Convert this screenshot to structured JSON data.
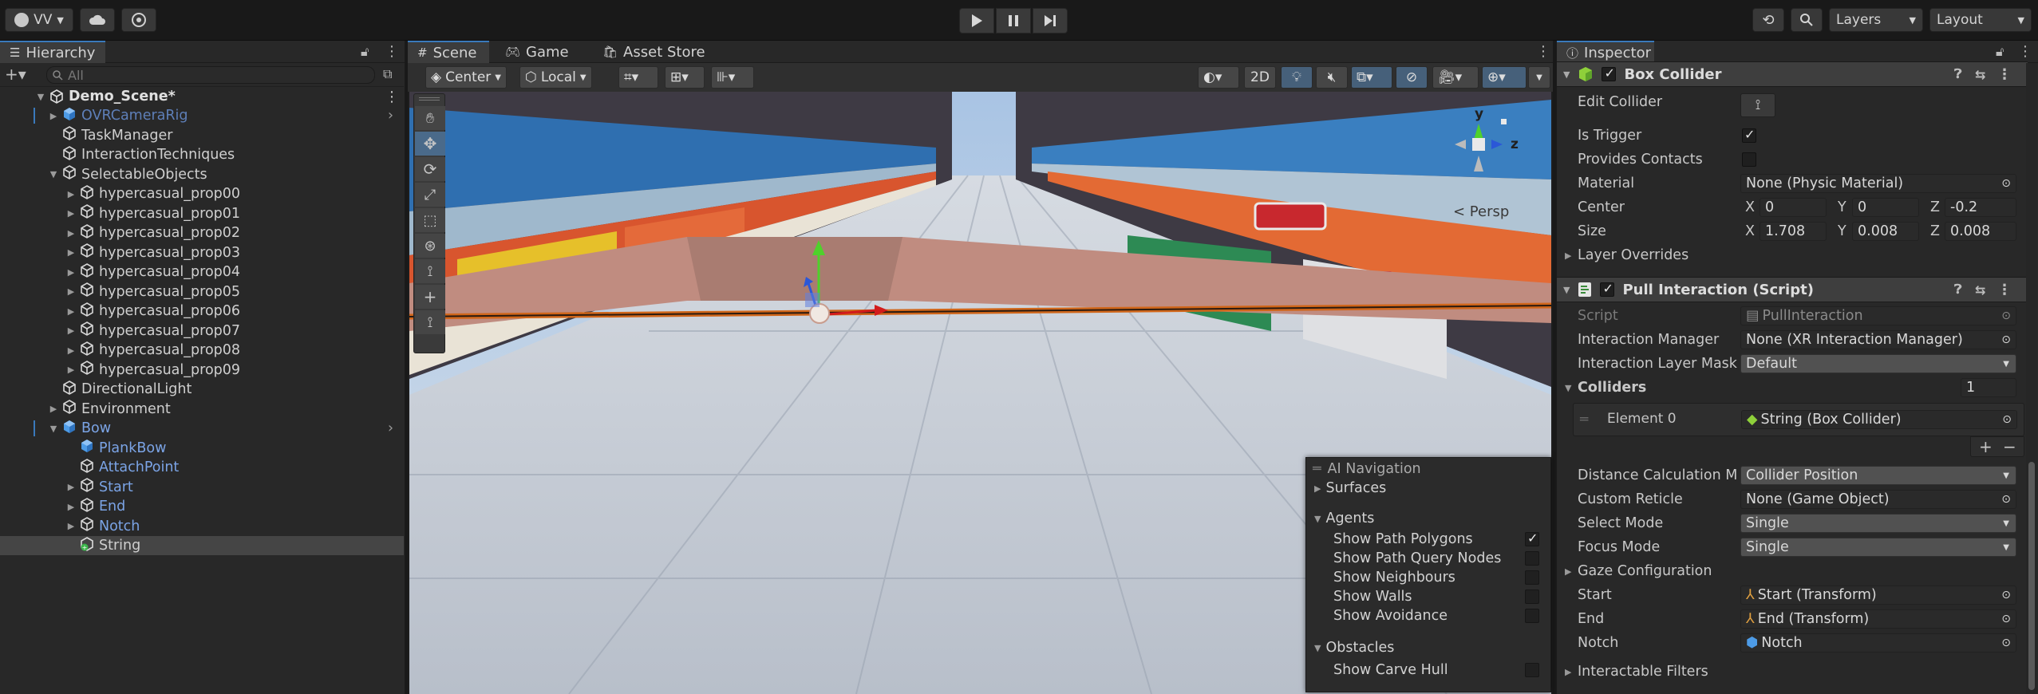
{
  "toolbar": {
    "account": "VV",
    "play_controls": [
      "play",
      "pause",
      "step"
    ],
    "layers_label": "Layers",
    "layout_label": "Layout"
  },
  "hierarchy": {
    "tab_label": "Hierarchy",
    "search_placeholder": "All",
    "scene_name": "Demo_Scene*",
    "items": [
      {
        "label": "OVRCameraRig",
        "depth": 1,
        "expand": "collapsed",
        "style": "prefab-faded",
        "icon": "prefab-cube-icon"
      },
      {
        "label": "TaskManager",
        "depth": 1,
        "expand": "none",
        "style": "normal",
        "icon": "gameobject-icon"
      },
      {
        "label": "InteractionTechniques",
        "depth": 1,
        "expand": "none",
        "style": "normal",
        "icon": "gameobject-icon"
      },
      {
        "label": "SelectableObjects",
        "depth": 1,
        "expand": "expanded",
        "style": "normal",
        "icon": "gameobject-icon"
      },
      {
        "label": "hypercasual_prop00",
        "depth": 2,
        "expand": "collapsed",
        "style": "normal",
        "icon": "gameobject-icon"
      },
      {
        "label": "hypercasual_prop01",
        "depth": 2,
        "expand": "collapsed",
        "style": "normal",
        "icon": "gameobject-icon"
      },
      {
        "label": "hypercasual_prop02",
        "depth": 2,
        "expand": "collapsed",
        "style": "normal",
        "icon": "gameobject-icon"
      },
      {
        "label": "hypercasual_prop03",
        "depth": 2,
        "expand": "collapsed",
        "style": "normal",
        "icon": "gameobject-icon"
      },
      {
        "label": "hypercasual_prop04",
        "depth": 2,
        "expand": "collapsed",
        "style": "normal",
        "icon": "gameobject-icon"
      },
      {
        "label": "hypercasual_prop05",
        "depth": 2,
        "expand": "collapsed",
        "style": "normal",
        "icon": "gameobject-icon"
      },
      {
        "label": "hypercasual_prop06",
        "depth": 2,
        "expand": "collapsed",
        "style": "normal",
        "icon": "gameobject-icon"
      },
      {
        "label": "hypercasual_prop07",
        "depth": 2,
        "expand": "collapsed",
        "style": "normal",
        "icon": "gameobject-icon"
      },
      {
        "label": "hypercasual_prop08",
        "depth": 2,
        "expand": "collapsed",
        "style": "normal",
        "icon": "gameobject-icon"
      },
      {
        "label": "hypercasual_prop09",
        "depth": 2,
        "expand": "collapsed",
        "style": "normal",
        "icon": "gameobject-icon"
      },
      {
        "label": "DirectionalLight",
        "depth": 1,
        "expand": "none",
        "style": "normal",
        "icon": "gameobject-icon"
      },
      {
        "label": "Environment",
        "depth": 1,
        "expand": "collapsed",
        "style": "normal",
        "icon": "gameobject-icon"
      },
      {
        "label": "Bow",
        "depth": 1,
        "expand": "expanded",
        "style": "prefab",
        "icon": "prefab-cube-icon"
      },
      {
        "label": "PlankBow",
        "depth": 2,
        "expand": "none",
        "style": "prefab",
        "icon": "prefab-cube-icon"
      },
      {
        "label": "AttachPoint",
        "depth": 2,
        "expand": "none",
        "style": "prefab",
        "icon": "gameobject-icon"
      },
      {
        "label": "Start",
        "depth": 2,
        "expand": "collapsed",
        "style": "prefab",
        "icon": "gameobject-icon"
      },
      {
        "label": "End",
        "depth": 2,
        "expand": "collapsed",
        "style": "prefab",
        "icon": "gameobject-icon"
      },
      {
        "label": "Notch",
        "depth": 2,
        "expand": "collapsed",
        "style": "prefab",
        "icon": "gameobject-icon"
      },
      {
        "label": "String",
        "depth": 2,
        "expand": "none",
        "style": "selected",
        "icon": "added-gameobject-icon"
      }
    ]
  },
  "scene": {
    "tabs": [
      {
        "label": "Scene",
        "icon": "grid-icon"
      },
      {
        "label": "Game",
        "icon": "gamepad-icon"
      },
      {
        "label": "Asset Store",
        "icon": "store-bag-icon"
      }
    ],
    "pivot_mode": "Center",
    "pivot_rotation": "Local",
    "mode_2d": "2D",
    "persp_label": "< Persp",
    "gizmo_axis_y": "y",
    "gizmo_axis_z": "z",
    "colors": {
      "sky": "#c4d2e0",
      "floor": "#c0c7d2",
      "plank": "#c08c80",
      "string": "#d0661a",
      "gizmo_y": "#4fd12b",
      "gizmo_x": "#d21b1b",
      "gizmo_z": "#2b57d8"
    }
  },
  "ai_nav": {
    "title": "AI Navigation",
    "surfaces": "Surfaces",
    "agents": "Agents",
    "agent_options": [
      {
        "label": "Show Path Polygons",
        "checked": true
      },
      {
        "label": "Show Path Query Nodes",
        "checked": false
      },
      {
        "label": "Show Neighbours",
        "checked": false
      },
      {
        "label": "Show Walls",
        "checked": false
      },
      {
        "label": "Show Avoidance",
        "checked": false
      }
    ],
    "obstacles": "Obstacles",
    "obstacle_options": [
      {
        "label": "Show Carve Hull",
        "checked": false
      }
    ]
  },
  "inspector": {
    "tab_label": "Inspector",
    "box_collider": {
      "title": "Box Collider",
      "edit_collider": "Edit Collider",
      "is_trigger_label": "Is Trigger",
      "is_trigger": true,
      "provides_contacts_label": "Provides Contacts",
      "provides_contacts": false,
      "material_label": "Material",
      "material_value": "None (Physic Material)",
      "center_label": "Center",
      "center": {
        "x": "0",
        "y": "0",
        "z": "-0.2"
      },
      "size_label": "Size",
      "size": {
        "x": "1.708",
        "y": "0.008",
        "z": "0.008"
      },
      "layer_overrides": "Layer Overrides"
    },
    "pull_interaction": {
      "title": "Pull Interaction (Script)",
      "script_label": "Script",
      "script_value": "PullInteraction",
      "manager_label": "Interaction Manager",
      "manager_value": "None (XR Interaction Manager)",
      "layer_mask_label": "Interaction Layer Mask",
      "layer_mask_value": "Default",
      "colliders_label": "Colliders",
      "colliders_count": "1",
      "element0_label": "Element 0",
      "element0_value": "String (Box Collider)",
      "distance_label": "Distance Calculation M",
      "distance_value": "Collider Position",
      "reticle_label": "Custom Reticle",
      "reticle_value": "None (Game Object)",
      "select_mode_label": "Select Mode",
      "select_mode_value": "Single",
      "focus_mode_label": "Focus Mode",
      "focus_mode_value": "Single",
      "gaze_label": "Gaze Configuration",
      "start_label": "Start",
      "start_value": "Start (Transform)",
      "end_label": "End",
      "end_value": "End (Transform)",
      "notch_label": "Notch",
      "notch_value": "Notch",
      "filters_label": "Interactable Filters"
    }
  }
}
